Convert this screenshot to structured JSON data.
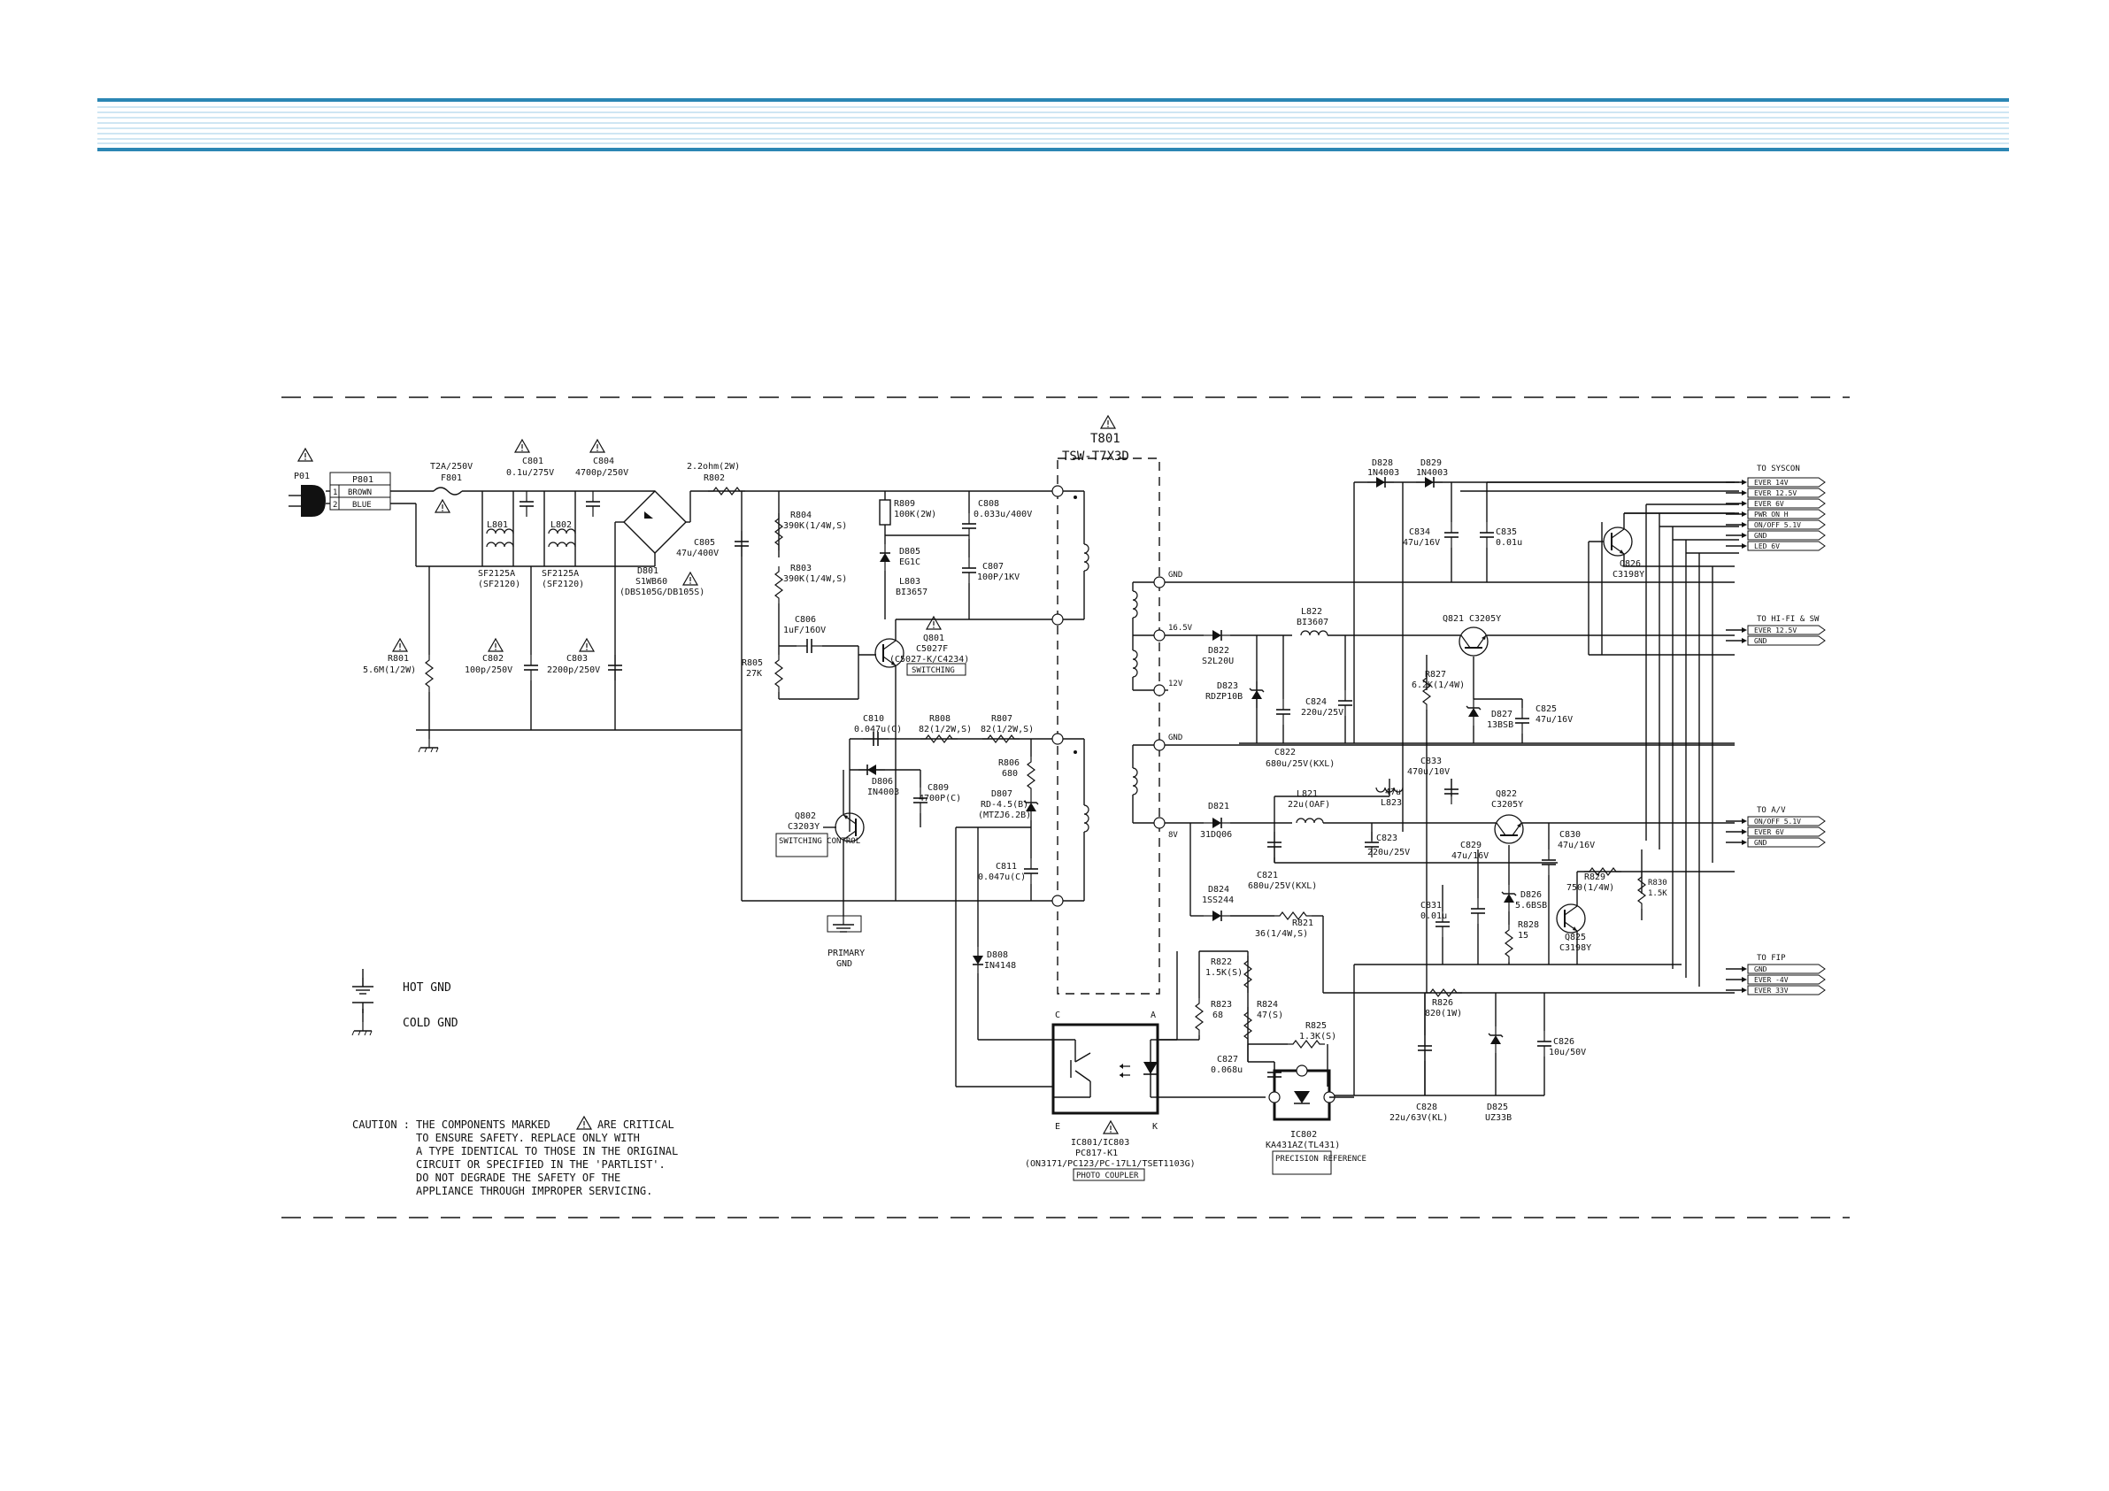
{
  "colors": {
    "header_band_dark": "#2b86b4",
    "header_band_light": "#cfe6f3",
    "ink": "#111111"
  },
  "transformer": {
    "ref": "T801",
    "part": "TSW-T7X3D"
  },
  "input": {
    "fuse": "F801",
    "fuse_rating": "T2A/250V",
    "connector": "P801",
    "pins": [
      {
        "num": "1",
        "name": "BROWN"
      },
      {
        "num": "2",
        "name": "BLUE"
      }
    ],
    "plug": "P01"
  },
  "components": [
    {
      "id": "C801",
      "lines": [
        "C801",
        "0.1u/275V"
      ]
    },
    {
      "id": "C804",
      "lines": [
        "C804",
        "4700p/250V"
      ]
    },
    {
      "id": "L801",
      "lines": [
        "L801",
        "SF2125A",
        "(SF2120)"
      ]
    },
    {
      "id": "L802",
      "lines": [
        "L802",
        "SF2125A",
        "(SF2120)"
      ]
    },
    {
      "id": "D801",
      "lines": [
        "D801",
        "S1WB60",
        "(DBS105G/DB105S)"
      ]
    },
    {
      "id": "R801",
      "lines": [
        "R801",
        "5.6M(1/2W)"
      ]
    },
    {
      "id": "C802",
      "lines": [
        "C802",
        "100p/250V"
      ]
    },
    {
      "id": "C803",
      "lines": [
        "C803",
        "2200p/250V"
      ]
    },
    {
      "id": "R802",
      "lines": [
        "2.2ohm(2W)",
        "R802"
      ]
    },
    {
      "id": "C805",
      "lines": [
        "C805",
        "47u/400V"
      ]
    },
    {
      "id": "R804",
      "lines": [
        "R804",
        "390K(1/4W,S)"
      ]
    },
    {
      "id": "R803",
      "lines": [
        "R803",
        "390K(1/4W,S)"
      ]
    },
    {
      "id": "R805",
      "lines": [
        "R805",
        "27K"
      ]
    },
    {
      "id": "C806",
      "lines": [
        "C806",
        "1uF/16OV"
      ]
    },
    {
      "id": "R809",
      "lines": [
        "R809",
        "100K(2W)"
      ]
    },
    {
      "id": "D805",
      "lines": [
        "D805",
        "EG1C"
      ]
    },
    {
      "id": "L803",
      "lines": [
        "L803",
        "BI3657"
      ]
    },
    {
      "id": "C808",
      "lines": [
        "C808",
        "0.033u/400V"
      ]
    },
    {
      "id": "C807",
      "lines": [
        "C807",
        "100P/1KV"
      ]
    },
    {
      "id": "Q801",
      "lines": [
        "Q801",
        "C5027F",
        "(C5027-K/C4234)"
      ],
      "tag": "SWITCHING"
    },
    {
      "id": "C810",
      "lines": [
        "C810",
        "0.047u(C)"
      ]
    },
    {
      "id": "R808",
      "lines": [
        "R808",
        "82(1/2W,S)"
      ]
    },
    {
      "id": "R807",
      "lines": [
        "R807",
        "82(1/2W,S)"
      ]
    },
    {
      "id": "D806",
      "lines": [
        "D806",
        "IN4003"
      ]
    },
    {
      "id": "C809",
      "lines": [
        "C809",
        "4700P(C)"
      ]
    },
    {
      "id": "R806",
      "lines": [
        "R806",
        "680"
      ]
    },
    {
      "id": "D807",
      "lines": [
        "D807",
        "RD-4.5(B)",
        "(MTZJ6.2B)"
      ]
    },
    {
      "id": "Q802",
      "lines": [
        "Q802",
        "C3203Y"
      ],
      "tag": "SWITCHING CONTROL"
    },
    {
      "id": "C811",
      "lines": [
        "C811",
        "0.047u(C)"
      ]
    },
    {
      "id": "D808",
      "lines": [
        "D808",
        "IN4148"
      ]
    },
    {
      "id": "D828",
      "lines": [
        "D828",
        "1N4003"
      ]
    },
    {
      "id": "D829",
      "lines": [
        "D829",
        "1N4003"
      ]
    },
    {
      "id": "C834",
      "lines": [
        "C834",
        "47u/16V"
      ]
    },
    {
      "id": "C835",
      "lines": [
        "C835",
        "0.01u"
      ]
    },
    {
      "id": "Q826",
      "lines": [
        "Q826",
        "C3198Y"
      ]
    },
    {
      "id": "D822",
      "lines": [
        "D822",
        "S2L20U"
      ]
    },
    {
      "id": "L822",
      "lines": [
        "L822",
        "BI3607"
      ]
    },
    {
      "id": "Q821",
      "lines": [
        "Q821",
        "C3205Y"
      ]
    },
    {
      "id": "D823",
      "lines": [
        "D823",
        "RDZP10B"
      ]
    },
    {
      "id": "C824",
      "lines": [
        "C824",
        "220u/25V"
      ]
    },
    {
      "id": "R827",
      "lines": [
        "R827",
        "6.2K(1/4W)"
      ]
    },
    {
      "id": "D827",
      "lines": [
        "D827",
        "13BSB"
      ]
    },
    {
      "id": "C825",
      "lines": [
        "C825",
        "47u/16V"
      ]
    },
    {
      "id": "C822",
      "lines": [
        "C822",
        "680u/25V(KXL)"
      ]
    },
    {
      "id": "C833",
      "lines": [
        "C833",
        "470u/10V"
      ]
    },
    {
      "id": "L823",
      "lines": [
        "47u",
        "L823"
      ]
    },
    {
      "id": "D821",
      "lines": [
        "D821",
        "31DQ06"
      ]
    },
    {
      "id": "L821",
      "lines": [
        "L821",
        "22u(OAF)"
      ]
    },
    {
      "id": "C823",
      "lines": [
        "C823",
        "220u/25V"
      ]
    },
    {
      "id": "Q822",
      "lines": [
        "Q822",
        "C3205Y"
      ]
    },
    {
      "id": "C829",
      "lines": [
        "C829",
        "47u/16V"
      ]
    },
    {
      "id": "C830",
      "lines": [
        "C830",
        "47u/16V"
      ]
    },
    {
      "id": "C821",
      "lines": [
        "C821",
        "680u/25V(KXL)"
      ]
    },
    {
      "id": "D826",
      "lines": [
        "D826",
        "5.6BSB"
      ]
    },
    {
      "id": "R829",
      "lines": [
        "R829",
        "750(1/4W)"
      ]
    },
    {
      "id": "R830",
      "lines": [
        "R830",
        "1.5K"
      ]
    },
    {
      "id": "D824",
      "lines": [
        "D824",
        "1SS244"
      ]
    },
    {
      "id": "R821",
      "lines": [
        "R821",
        "36(1/4W,S)"
      ]
    },
    {
      "id": "C831",
      "lines": [
        "C831",
        "0.01u"
      ]
    },
    {
      "id": "R828",
      "lines": [
        "R828",
        "15"
      ]
    },
    {
      "id": "Q825",
      "lines": [
        "Q825",
        "C3198Y"
      ]
    },
    {
      "id": "R822",
      "lines": [
        "R822",
        "1.5K(S)"
      ]
    },
    {
      "id": "R823",
      "lines": [
        "R823",
        "68"
      ]
    },
    {
      "id": "R824",
      "lines": [
        "R824",
        "47(S)"
      ]
    },
    {
      "id": "R825",
      "lines": [
        "R825",
        "1.3K(S)"
      ]
    },
    {
      "id": "C827",
      "lines": [
        "C827",
        "0.068u"
      ]
    },
    {
      "id": "R826",
      "lines": [
        "R826",
        "820(1W)"
      ]
    },
    {
      "id": "C828",
      "lines": [
        "C828",
        "22u/63V(KL)"
      ]
    },
    {
      "id": "D825",
      "lines": [
        "D825",
        "UZ33B"
      ]
    },
    {
      "id": "C826",
      "lines": [
        "C826",
        "10u/50V"
      ]
    }
  ],
  "rails": {
    "v1": "16.5V",
    "v2": "12V",
    "v3": "8V",
    "gnd1": "GND",
    "gnd2": "GND"
  },
  "photo_coupler": {
    "ref": "IC801/IC803",
    "part": "PC817-K1",
    "alt": "(ON3171/PC123/PC-17L1/TSET1103G)",
    "tag": "PHOTO COUPLER",
    "pin_c": "C",
    "pin_a": "A",
    "pin_e": "E",
    "pin_k": "K"
  },
  "reference": {
    "ref": "IC802",
    "part": "KA431AZ(TL431)",
    "tag": "PRECISION REFERENCE"
  },
  "primary_gnd": {
    "line1": "PRIMARY",
    "line2": "GND"
  },
  "outputs": [
    {
      "group": "TO SYSCON",
      "pins": [
        "EVER 14V",
        "EVER 12.5V",
        "EVER 6V",
        "PWR ON H",
        "ON/OFF 5.1V",
        "GND",
        "LED 6V"
      ]
    },
    {
      "group": "TO HI-FI & SW",
      "pins": [
        "EVER 12.5V",
        "GND"
      ]
    },
    {
      "group": "TO A/V",
      "pins": [
        "ON/OFF 5.1V",
        "EVER 6V",
        "GND"
      ]
    },
    {
      "group": "TO FIP",
      "pins": [
        "GND",
        "EVER -4V",
        "EVER 33V"
      ]
    }
  ],
  "legend": {
    "hot": "HOT GND",
    "cold": "COLD GND"
  },
  "caution": {
    "label": "CAUTION :",
    "lines": [
      "THE COMPONENTS MARKED",
      "TO ENSURE SAFETY.  REPLACE ONLY WITH",
      "A TYPE IDENTICAL TO THOSE IN THE ORIGINAL",
      "CIRCUIT OR SPECIFIED IN THE 'PARTLIST'.",
      "DO NOT DEGRADE THE SAFETY OF THE",
      "APPLIANCE THROUGH IMPROPER SERVICING."
    ],
    "line1_tail": "ARE CRITICAL"
  }
}
